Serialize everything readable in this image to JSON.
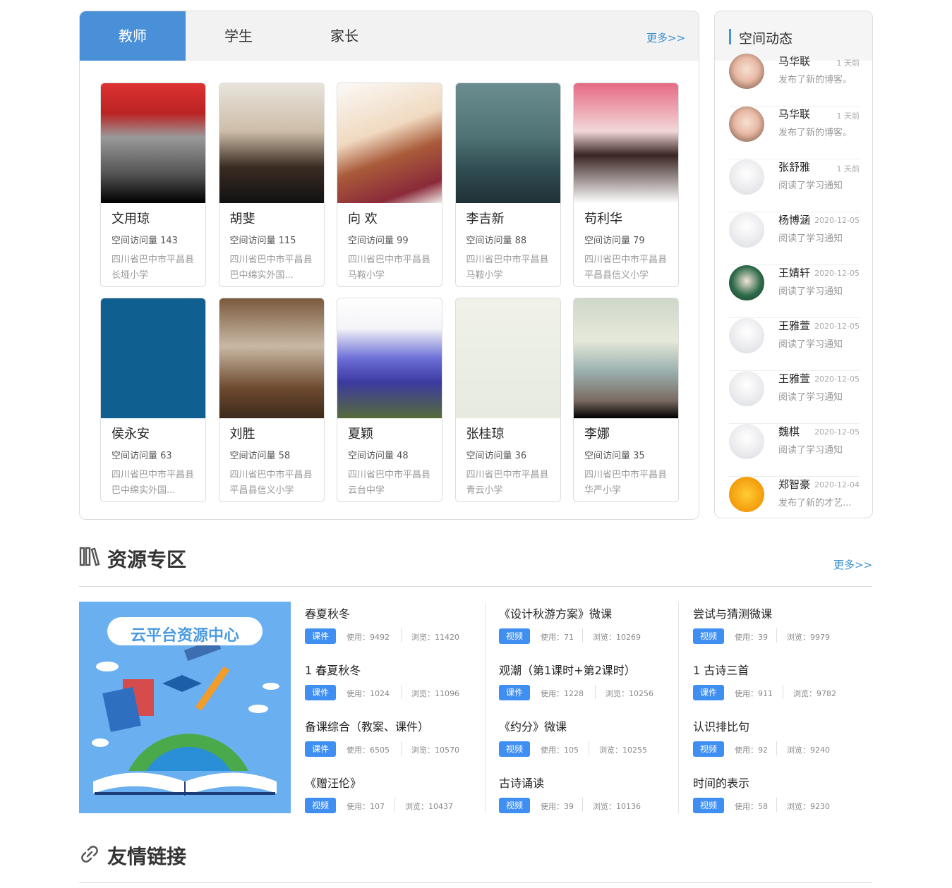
{
  "tabs": [
    {
      "label": "教师"
    },
    {
      "label": "学生"
    },
    {
      "label": "家长"
    }
  ],
  "more_label": "更多>>",
  "teachers": [
    {
      "name": "文用琼",
      "visits": "空间访问量 143",
      "school": "四川省巴中市平昌县长垭小学"
    },
    {
      "name": "胡斐",
      "visits": "空间访问量 115",
      "school": "四川省巴中市平昌县巴中绵实外国..."
    },
    {
      "name": "向 欢",
      "visits": "空间访问量 99",
      "school": "四川省巴中市平昌县马鞍小学"
    },
    {
      "name": "李吉新",
      "visits": "空间访问量 88",
      "school": "四川省巴中市平昌县马鞍小学"
    },
    {
      "name": "苟利华",
      "visits": "空间访问量 79",
      "school": "四川省巴中市平昌县平昌县信义小学"
    },
    {
      "name": "侯永安",
      "visits": "空间访问量 63",
      "school": "四川省巴中市平昌县巴中绵实外国..."
    },
    {
      "name": "刘胜",
      "visits": "空间访问量 58",
      "school": "四川省巴中市平昌县平昌县信义小学"
    },
    {
      "name": "夏颖",
      "visits": "空间访问量 48",
      "school": "四川省巴中市平昌县云台中学"
    },
    {
      "name": "张桂琼",
      "visits": "空间访问量 36",
      "school": "四川省巴中市平昌县青云小学"
    },
    {
      "name": "李娜",
      "visits": "空间访问量 35",
      "school": "四川省巴中市平昌县华严小学"
    }
  ],
  "side": {
    "title": "空间动态"
  },
  "feed": [
    {
      "name": "马华联",
      "time": "1 天前",
      "action": "发布了新的博客。"
    },
    {
      "name": "马华联",
      "time": "1 天前",
      "action": "发布了新的博客。"
    },
    {
      "name": "张舒雅",
      "time": "1 天前",
      "action": "阅读了学习通知"
    },
    {
      "name": "杨博涵",
      "time": "2020-12-05",
      "action": "阅读了学习通知"
    },
    {
      "name": "王婧轩",
      "time": "2020-12-05",
      "action": "阅读了学习通知"
    },
    {
      "name": "王雅萱",
      "time": "2020-12-05",
      "action": "阅读了学习通知"
    },
    {
      "name": "王雅萱",
      "time": "2020-12-05",
      "action": "阅读了学习通知"
    },
    {
      "name": "魏棋",
      "time": "2020-12-05",
      "action": "阅读了学习通知"
    },
    {
      "name": "郑智豪",
      "time": "2020-12-04",
      "action": "发布了新的才艺..."
    }
  ],
  "resources": {
    "title": "资源专区",
    "banner_text": "云平台资源中心",
    "columns": [
      [
        {
          "title": "春夏秋冬",
          "tag": "课件",
          "use": "使用：9492",
          "view": "浏览：11420"
        },
        {
          "title": "1 春夏秋冬",
          "tag": "课件",
          "use": "使用：1024",
          "view": "浏览：11096"
        },
        {
          "title": "备课综合（教案、课件）",
          "tag": "课件",
          "use": "使用：6505",
          "view": "浏览：10570"
        },
        {
          "title": "《赠汪伦》",
          "tag": "视频",
          "use": "使用：107",
          "view": "浏览：10437"
        }
      ],
      [
        {
          "title": "《设计秋游方案》微课",
          "tag": "视频",
          "use": "使用：71",
          "view": "浏览：10269"
        },
        {
          "title": "观潮（第1课时+第2课时）",
          "tag": "课件",
          "use": "使用：1228",
          "view": "浏览：10256"
        },
        {
          "title": "《约分》微课",
          "tag": "视频",
          "use": "使用：105",
          "view": "浏览：10255"
        },
        {
          "title": "古诗诵读",
          "tag": "视频",
          "use": "使用：39",
          "view": "浏览：10136"
        }
      ],
      [
        {
          "title": "尝试与猜测微课",
          "tag": "视频",
          "use": "使用：39",
          "view": "浏览：9979"
        },
        {
          "title": "1 古诗三首",
          "tag": "课件",
          "use": "使用：911",
          "view": "浏览：9782"
        },
        {
          "title": "认识排比句",
          "tag": "视频",
          "use": "使用：92",
          "view": "浏览：9240"
        },
        {
          "title": "时间的表示",
          "tag": "视频",
          "use": "使用：58",
          "view": "浏览：9230"
        }
      ]
    ]
  },
  "links": {
    "title": "友情链接"
  },
  "colors": {
    "accent": "#4a90d9",
    "link": "#3a8fd0",
    "tag": "#3f8ef2"
  }
}
